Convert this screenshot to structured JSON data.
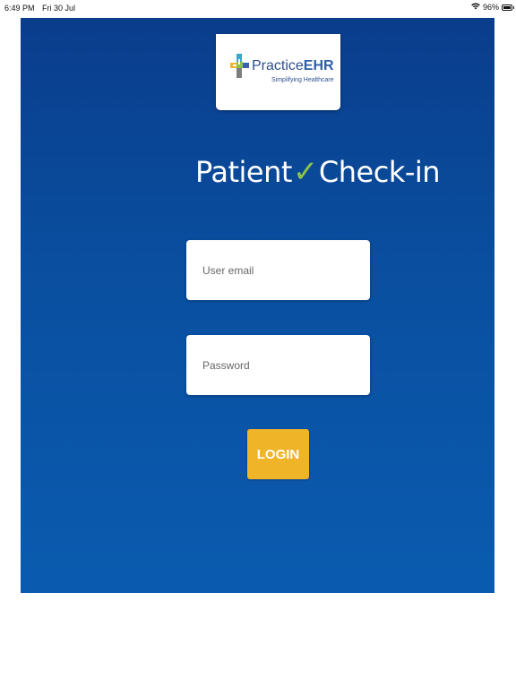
{
  "status_bar": {
    "time": "6:49 PM",
    "date": "Fri 30 Jul",
    "battery": "96%",
    "icons": [
      "wifi-icon",
      "battery-icon"
    ]
  },
  "logo": {
    "brand_prefix": "Practice",
    "brand_suffix": "EHR",
    "tagline": "Simplifying Healthcare"
  },
  "title": {
    "part1": "Patient",
    "check_glyph": "✓",
    "part2": "Check-in"
  },
  "form": {
    "email_placeholder": "User email",
    "email_value": "",
    "password_placeholder": "Password",
    "password_value": "",
    "login_label": "LOGIN"
  },
  "colors": {
    "panel_top": "#0a3d8c",
    "panel_bottom": "#0a5bb0",
    "login_button": "#f0b429",
    "check_mark": "#8bc34a"
  }
}
